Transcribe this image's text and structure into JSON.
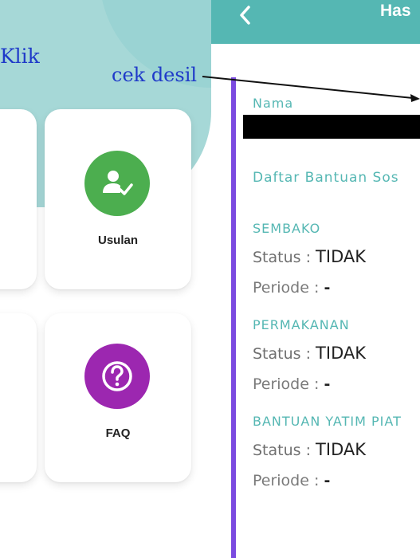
{
  "left_panel": {
    "klik_text": "Klik",
    "cards": [
      {
        "label": "Usulan",
        "icon": "user-check-icon",
        "icon_color": "#4cae4f"
      },
      {
        "label": "FAQ",
        "icon": "question-icon",
        "icon_color": "#9c27b0"
      }
    ]
  },
  "annotation": {
    "text": "cek desil"
  },
  "right_panel": {
    "appbar": {
      "title": "Has",
      "back_icon": "chevron-left-icon",
      "background_color": "#55b7b3"
    },
    "nama_label": "Nama",
    "daftar_label": "Daftar Bantuan Sos",
    "programs": [
      {
        "name": "SEMBAKO",
        "status_label": "Status :",
        "status_value": "TIDAK",
        "periode_label": "Periode :",
        "periode_value": "-"
      },
      {
        "name": "PERMAKANAN",
        "status_label": "Status :",
        "status_value": "TIDAK",
        "periode_label": "Periode :",
        "periode_value": "-"
      },
      {
        "name": "BANTUAN YATIM PIAT",
        "status_label": "Status :",
        "status_value": "TIDAK",
        "periode_label": "Periode :",
        "periode_value": "-"
      }
    ],
    "accent_color": "#7b4be0"
  }
}
